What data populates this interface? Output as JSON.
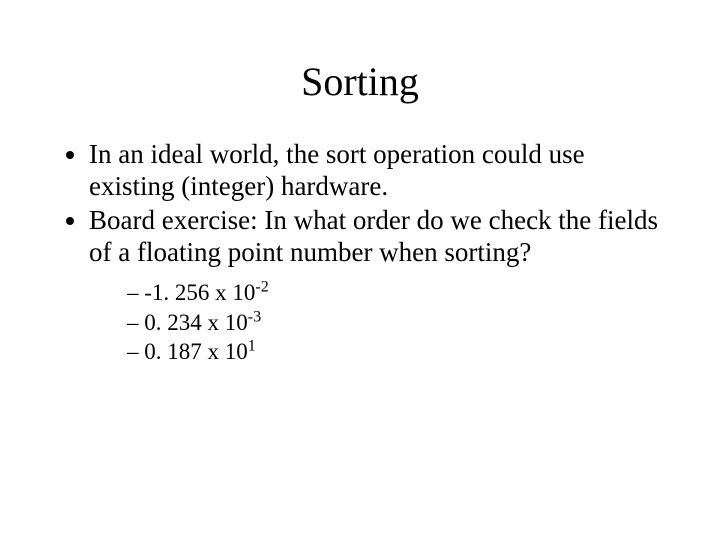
{
  "title": "Sorting",
  "bullets": [
    "In an ideal world, the sort operation could use existing (integer) hardware.",
    "Board exercise: In what order do we check the fields of a floating point number when sorting?"
  ],
  "examples": [
    {
      "mantissa": "-1. 256 x 10",
      "exp": "-2"
    },
    {
      "mantissa": "0. 234 x 10",
      "exp": "-3"
    },
    {
      "mantissa": "0. 187 x 10",
      "exp": "1"
    }
  ]
}
